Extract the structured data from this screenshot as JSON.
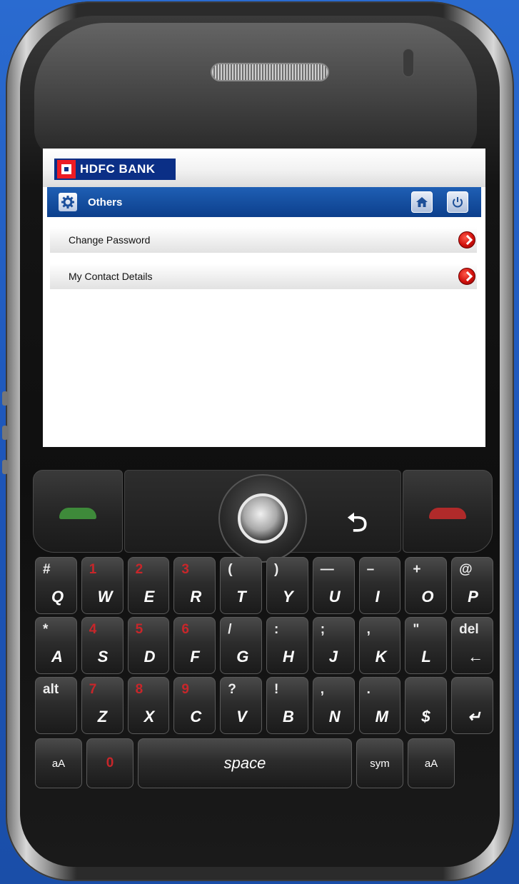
{
  "app": {
    "brand": "HDFC BANK",
    "section_title": "Others",
    "menu_items": [
      {
        "label": "Change Password"
      },
      {
        "label": "My Contact Details"
      }
    ]
  },
  "icons": {
    "section": "gear-icon",
    "home": "home-icon",
    "logout": "power-icon",
    "item_arrow": "chevron-right-icon"
  },
  "colors": {
    "brand_blue": "#0b2f86",
    "brand_red": "#ed1c24",
    "title_bar": "#0c3f8c",
    "arrow_red": "#d0100c"
  },
  "keyboard": {
    "row1": [
      {
        "sub": "#",
        "main": "Q"
      },
      {
        "sub": "1",
        "main": "W"
      },
      {
        "sub": "2",
        "main": "E"
      },
      {
        "sub": "3",
        "main": "R"
      },
      {
        "sub": "(",
        "main": "T"
      },
      {
        "sub": ")",
        "main": "Y"
      },
      {
        "sub": "—",
        "main": "U"
      },
      {
        "sub": "–",
        "main": "I"
      },
      {
        "sub": "+",
        "main": "O"
      },
      {
        "sub": "@",
        "main": "P"
      }
    ],
    "row2": [
      {
        "sub": "*",
        "main": "A"
      },
      {
        "sub": "4",
        "main": "S"
      },
      {
        "sub": "5",
        "main": "D"
      },
      {
        "sub": "6",
        "main": "F"
      },
      {
        "sub": "/",
        "main": "G"
      },
      {
        "sub": ":",
        "main": "H"
      },
      {
        "sub": ";",
        "main": "J"
      },
      {
        "sub": ",",
        "main": "K"
      },
      {
        "sub": "\"",
        "main": "L"
      },
      {
        "sub": "del",
        "main": "←"
      }
    ],
    "row3": [
      {
        "sub": "alt",
        "main": ""
      },
      {
        "sub": "7",
        "main": "Z"
      },
      {
        "sub": "8",
        "main": "X"
      },
      {
        "sub": "9",
        "main": "C"
      },
      {
        "sub": "?",
        "main": "V"
      },
      {
        "sub": "!",
        "main": "B"
      },
      {
        "sub": ",",
        "main": "N"
      },
      {
        "sub": ".",
        "main": "M"
      },
      {
        "sub": "",
        "main": "$"
      },
      {
        "sub": "",
        "main": "↵"
      }
    ],
    "shift_left": "aA",
    "zero": "0",
    "space": "space",
    "sym": "sym",
    "shift_right": "aA"
  }
}
